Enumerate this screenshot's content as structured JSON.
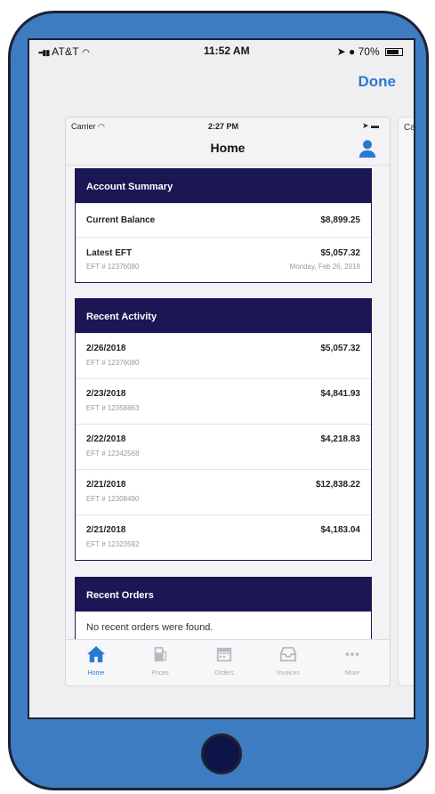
{
  "outer_status": {
    "carrier": "AT&T",
    "time": "11:52 AM",
    "battery": "70%"
  },
  "done_label": "Done",
  "back_card_label": "Ca",
  "inner_status": {
    "carrier": "Carrier",
    "time": "2:27 PM"
  },
  "nav": {
    "title": "Home"
  },
  "account_summary": {
    "title": "Account Summary",
    "current_balance_label": "Current Balance",
    "current_balance_value": "$8,899.25",
    "latest_eft_label": "Latest EFT",
    "latest_eft_value": "$5,057.32",
    "latest_eft_number": "EFT # 12376080",
    "latest_eft_date": "Monday, Feb 26, 2018"
  },
  "recent_activity": {
    "title": "Recent Activity",
    "items": [
      {
        "date": "2/26/2018",
        "eft": "EFT # 12376080",
        "amount": "$5,057.32"
      },
      {
        "date": "2/23/2018",
        "eft": "EFT # 12358863",
        "amount": "$4,841.93"
      },
      {
        "date": "2/22/2018",
        "eft": "EFT # 12342568",
        "amount": "$4,218.83"
      },
      {
        "date": "2/21/2018",
        "eft": "EFT # 12308490",
        "amount": "$12,838.22"
      },
      {
        "date": "2/21/2018",
        "eft": "EFT # 12323592",
        "amount": "$4,183.04"
      }
    ]
  },
  "recent_orders": {
    "title": "Recent Orders",
    "empty_text": "No recent orders were found."
  },
  "tabs": [
    {
      "label": "Home",
      "icon": "home-icon",
      "active": true
    },
    {
      "label": "Prices",
      "icon": "fuel-pump-icon",
      "active": false
    },
    {
      "label": "Orders",
      "icon": "calendar-icon",
      "active": false
    },
    {
      "label": "Invoices",
      "icon": "inbox-icon",
      "active": false
    },
    {
      "label": "More",
      "icon": "more-dots-icon",
      "active": false
    }
  ],
  "colors": {
    "device_body": "#3d7cc1",
    "panel_header": "#1b1654",
    "accent": "#2979d0",
    "home_button": "#0e1448"
  }
}
